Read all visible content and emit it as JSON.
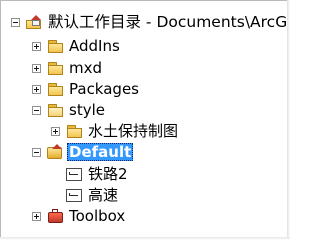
{
  "tree": {
    "root": {
      "label": "默认工作目录 - Documents\\ArcGIS"
    },
    "folders": [
      {
        "label": "AddIns"
      },
      {
        "label": "mxd"
      },
      {
        "label": "Packages"
      },
      {
        "label": "style"
      }
    ],
    "style_child": {
      "label": "水土保持制图"
    },
    "geodatabase": {
      "label": "Default"
    },
    "layers": [
      {
        "label": "铁路2"
      },
      {
        "label": "高速"
      }
    ],
    "toolbox": {
      "label": "Toolbox"
    }
  }
}
